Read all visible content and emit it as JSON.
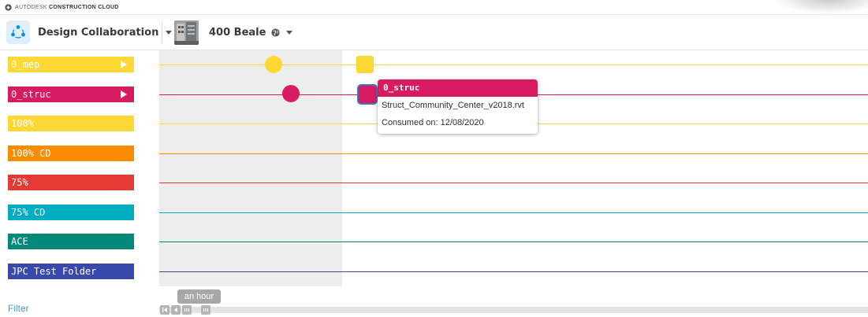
{
  "brand": {
    "prefix": "AUTODESK",
    "product": "CONSTRUCTION CLOUD"
  },
  "header": {
    "module_label": "Design Collaboration",
    "project_label": "400 Beale"
  },
  "sidebar": {
    "folders": [
      {
        "label": "0_mep",
        "color": "#fdd835",
        "has_play": true
      },
      {
        "label": "0_struc",
        "color": "#d81b60",
        "has_play": true
      },
      {
        "label": "100%",
        "color": "#fdd835",
        "has_play": false
      },
      {
        "label": "100% CD",
        "color": "#fb8c00",
        "has_play": false
      },
      {
        "label": "75%",
        "color": "#e53935",
        "has_play": false
      },
      {
        "label": "75% CD",
        "color": "#00acc1",
        "has_play": false
      },
      {
        "label": "ACE",
        "color": "#00897b",
        "has_play": false
      },
      {
        "label": "JPC Test Folder",
        "color": "#3949ab",
        "has_play": false
      }
    ],
    "filter_label": "Filter"
  },
  "tooltip": {
    "title": "0_struc",
    "file": "Struct_Community_Center_v2018.rvt",
    "consumed": "Consumed on: 12/08/2020"
  },
  "zoom_label": "an hour",
  "colors": {
    "shade": "#ededed",
    "accent": "#3a72c4",
    "link": "#3a9bd6"
  }
}
